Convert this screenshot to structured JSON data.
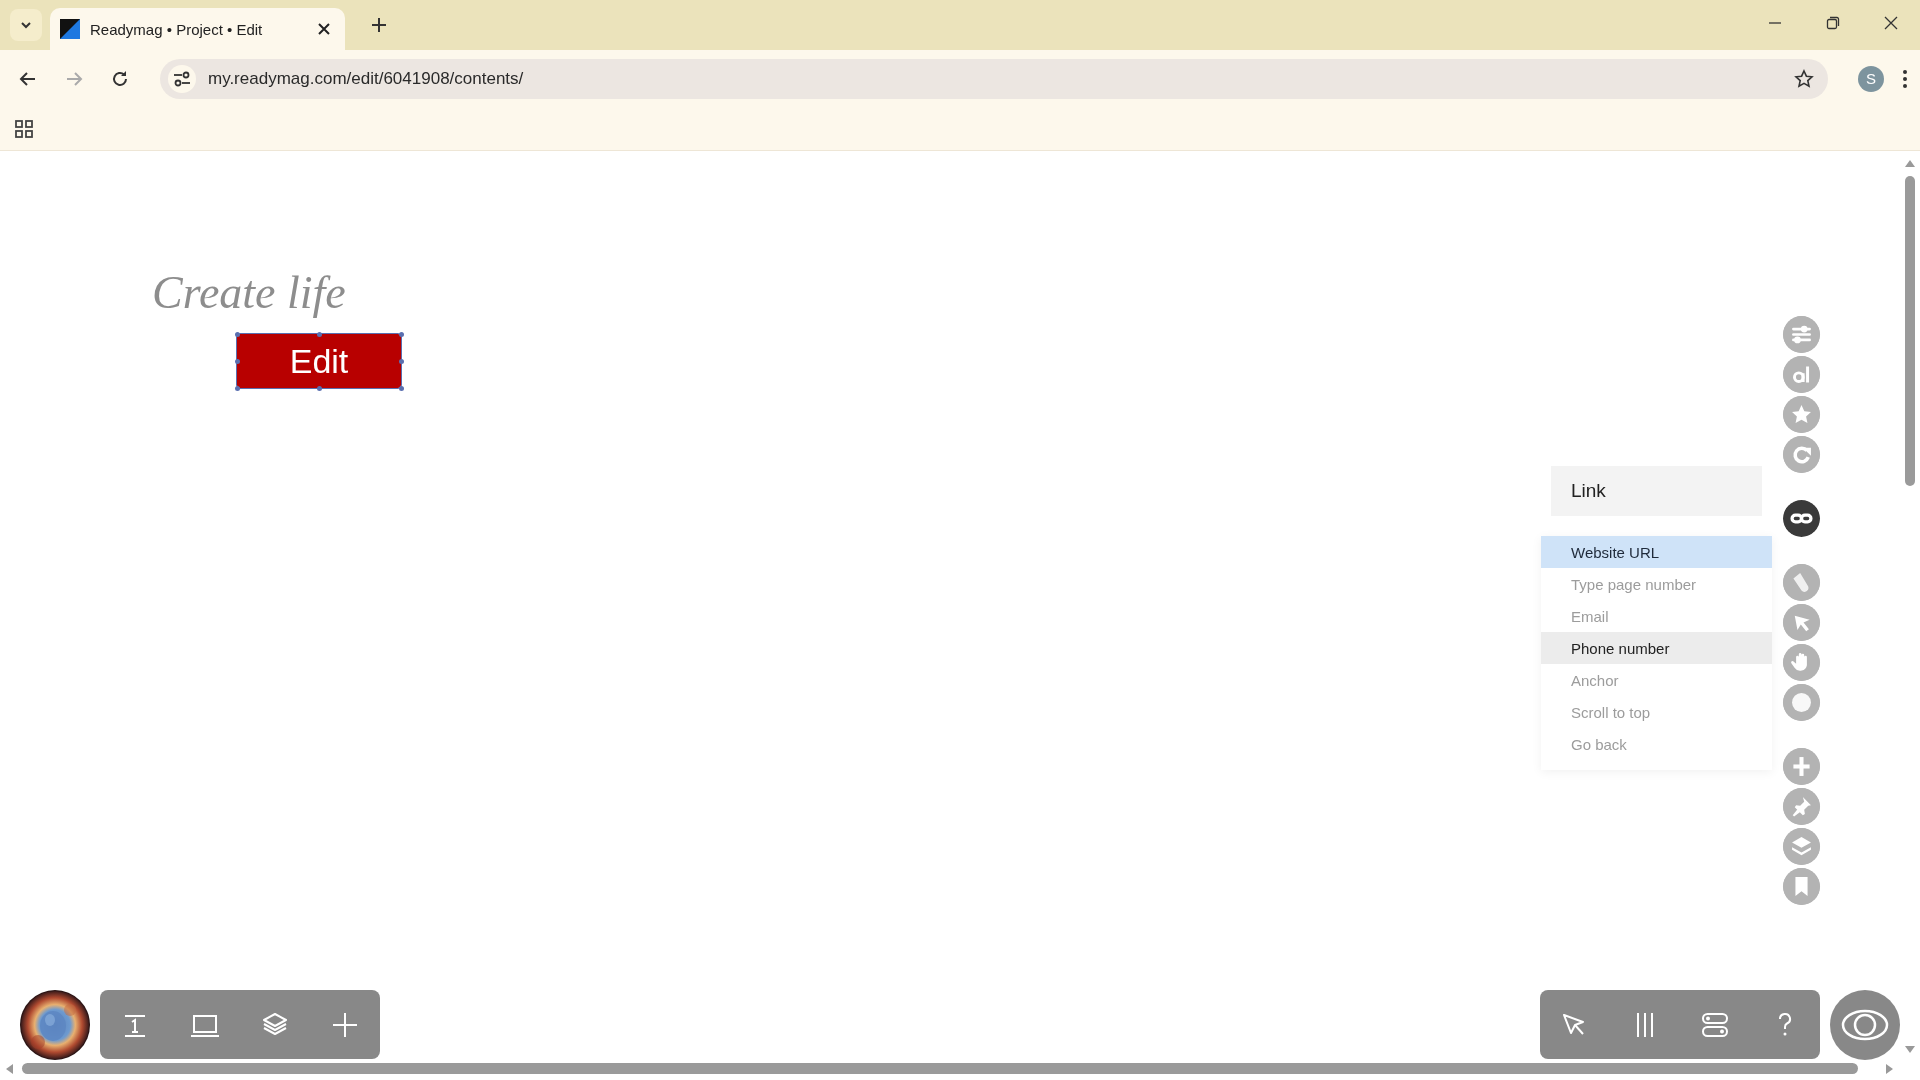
{
  "browser": {
    "tab_title": "Readymag • Project • Edit",
    "url": "my.readymag.com/edit/6041908/contents/",
    "profile_initial": "S"
  },
  "canvas": {
    "heading": "Create life",
    "button_label": "Edit",
    "button_selected": true
  },
  "link_panel": {
    "title": "Link",
    "options": [
      {
        "label": "Website URL",
        "selected": true,
        "hovered": false
      },
      {
        "label": "Type page number",
        "selected": false,
        "hovered": false
      },
      {
        "label": "Email",
        "selected": false,
        "hovered": false
      },
      {
        "label": "Phone number",
        "selected": false,
        "hovered": true
      },
      {
        "label": "Anchor",
        "selected": false,
        "hovered": false
      },
      {
        "label": "Scroll to top",
        "selected": false,
        "hovered": false
      },
      {
        "label": "Go back",
        "selected": false,
        "hovered": false
      }
    ]
  },
  "side_tool_groups": [
    {
      "tools": [
        {
          "kind": "sliders",
          "active": false
        },
        {
          "kind": "text",
          "active": false
        },
        {
          "kind": "star",
          "active": false
        },
        {
          "kind": "rotate",
          "active": false
        }
      ]
    },
    {
      "tools": [
        {
          "kind": "link",
          "active": true
        }
      ]
    },
    {
      "tools": [
        {
          "kind": "opacity",
          "active": false
        },
        {
          "kind": "cursor",
          "active": false
        },
        {
          "kind": "hand",
          "active": false
        },
        {
          "kind": "glow",
          "active": false
        }
      ]
    },
    {
      "tools": [
        {
          "kind": "plus",
          "active": false
        },
        {
          "kind": "pin",
          "active": false
        },
        {
          "kind": "layers",
          "active": false
        },
        {
          "kind": "bookmark",
          "active": false
        }
      ]
    }
  ],
  "bottom_left_tools": [
    {
      "kind": "page-number"
    },
    {
      "kind": "screen"
    },
    {
      "kind": "layers"
    },
    {
      "kind": "plus"
    }
  ],
  "bottom_right_tools": [
    {
      "kind": "cursor"
    },
    {
      "kind": "columns"
    },
    {
      "kind": "toggles"
    },
    {
      "kind": "help"
    }
  ]
}
